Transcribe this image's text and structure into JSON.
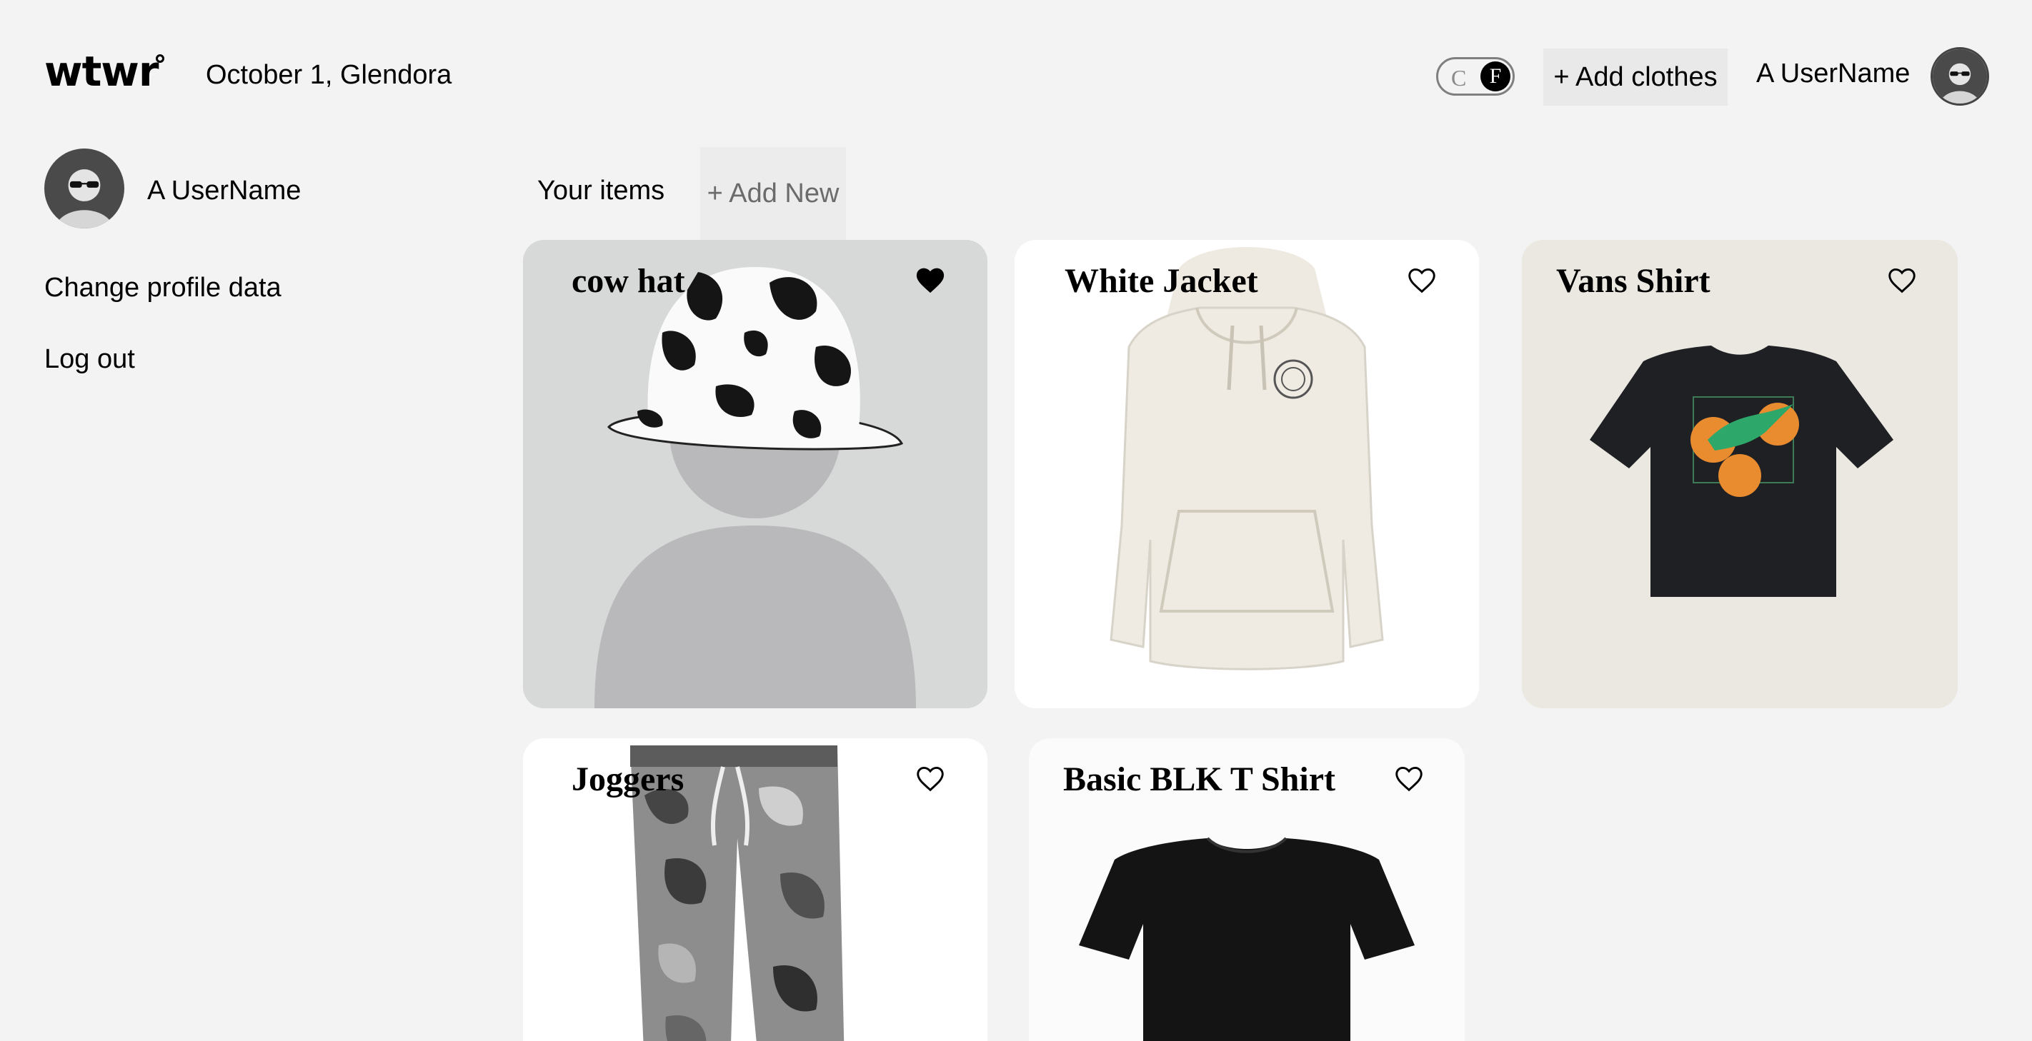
{
  "header": {
    "logo": "wtwr",
    "date_location": "October 1, Glendora",
    "temp_toggle": {
      "off_label": "C",
      "on_label": "F",
      "active": "F"
    },
    "add_clothes_label": "+ Add clothes",
    "username": "A UserName"
  },
  "sidebar": {
    "username": "A UserName",
    "change_profile_label": "Change profile data",
    "logout_label": "Log out"
  },
  "items": {
    "title": "Your items",
    "add_new_label": "+ Add New",
    "cards": [
      {
        "name": "cow hat",
        "liked": true
      },
      {
        "name": "White Jacket",
        "liked": false
      },
      {
        "name": "Vans Shirt",
        "liked": false
      },
      {
        "name": "Joggers",
        "liked": false
      },
      {
        "name": "Basic BLK T Shirt",
        "liked": false
      }
    ]
  },
  "colors": {
    "background": "#f3f3f3",
    "text": "#000000",
    "button_bg": "#e9e9e9",
    "muted_text": "#6b6b6b"
  }
}
